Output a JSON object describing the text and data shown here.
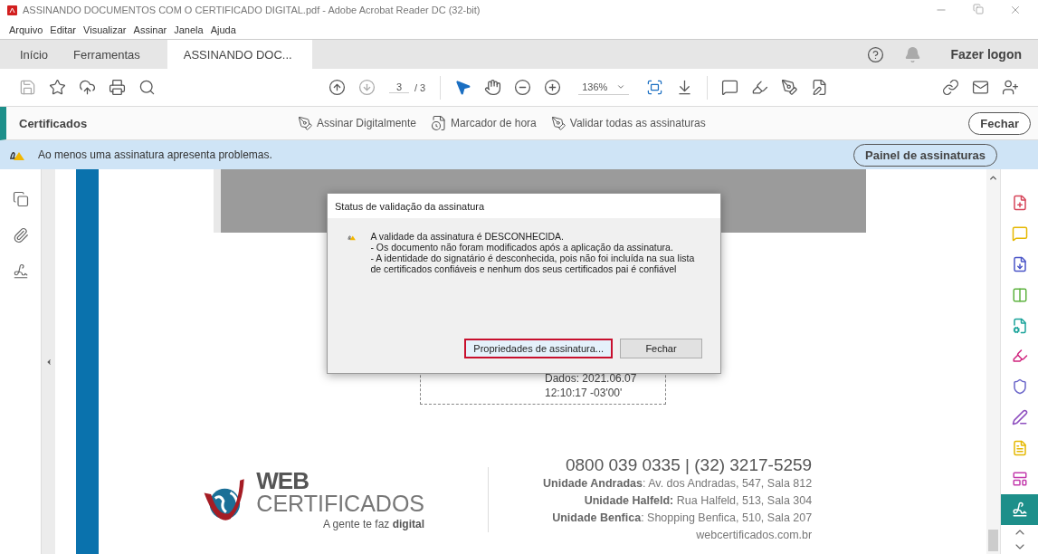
{
  "window": {
    "title": "ASSINANDO DOCUMENTOS COM O CERTIFICADO DIGITAL.pdf - Adobe Acrobat Reader DC (32-bit)"
  },
  "menu": [
    "Arquivo",
    "Editar",
    "Visualizar",
    "Assinar",
    "Janela",
    "Ajuda"
  ],
  "tabs": [
    {
      "label": "Início",
      "selected": false
    },
    {
      "label": "Ferramentas",
      "selected": false
    },
    {
      "label": "ASSINANDO DOC...",
      "selected": true
    }
  ],
  "account": {
    "label": "Fazer logon"
  },
  "toolbar": {
    "page": "3",
    "page_total": "/ 3",
    "zoom": "136%",
    "tools": [
      {
        "selected": true
      },
      {
        "selected": false
      }
    ]
  },
  "certificates_bar": {
    "title": "Certificados",
    "actions": [
      "Assinar Digitalmente",
      "Marcador de hora",
      "Validar todas as assinaturas"
    ],
    "close": "Fechar"
  },
  "notification": {
    "message": "Ao menos uma assinatura apresenta problemas.",
    "button": "Painel de assinaturas"
  },
  "document": {
    "signature_lines": [
      "Dados: 2021.06.07",
      "12:10:17 -03'00'"
    ],
    "footer": {
      "logo_top": "WEB",
      "logo_bottom": "CERTIFICADOS",
      "tagline": "A gente te faz **digital**",
      "phone": "0800 039 0335 | (32) 3217-5259",
      "units": [
        "**Unidade Andradas**: Av. dos Andradas, 547, Sala 812",
        "**Unidade Halfeld:** Rua Halfeld, 513, Sala 304",
        "**Unidade Benfica**: Shopping Benfica, 510, Sala 207"
      ],
      "website": "webcertificados.com.br"
    }
  },
  "right_rail": [
    {
      "selected": false
    },
    {
      "selected": false
    },
    {
      "selected": false
    },
    {
      "selected": false
    },
    {
      "selected": false
    },
    {
      "selected": false
    },
    {
      "selected": false
    },
    {
      "selected": false
    },
    {
      "selected": false
    },
    {
      "selected": false
    },
    {
      "selected": true
    }
  ],
  "dialog": {
    "title": "Status de validação da assinatura",
    "heading": "A validade da assinatura é DESCONHECIDA.",
    "lines": [
      "- Os documento não foram modificados após a aplicação da assinatura.",
      "- A identidade do signatário é desconhecida, pois não foi incluída na sua lista de certificados confiáveis e nenhum dos seus certificados pai é confiável"
    ],
    "buttons": [
      {
        "label": "Propriedades de assinatura...",
        "focused": true
      },
      {
        "label": "Fechar",
        "focused": false
      }
    ]
  }
}
